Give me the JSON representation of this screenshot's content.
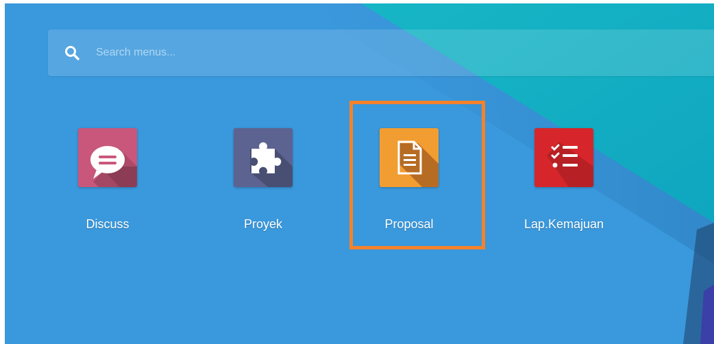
{
  "search": {
    "placeholder": "Search menus..."
  },
  "apps": [
    {
      "label": "Discuss",
      "icon": "chat-bubble-icon",
      "color": "#c9577b"
    },
    {
      "label": "Proyek",
      "icon": "puzzle-piece-icon",
      "color": "#5c6390"
    },
    {
      "label": "Proposal",
      "icon": "document-icon",
      "color": "#f29d31"
    },
    {
      "label": "Lap.Kemajuan",
      "icon": "checklist-icon",
      "color": "#d6262b"
    }
  ],
  "highlight": {
    "target": "Proposal",
    "color": "#f5822a"
  },
  "colors": {
    "background": "#3a98dc",
    "accent": "#19b3c8",
    "text": "#ffffff"
  }
}
